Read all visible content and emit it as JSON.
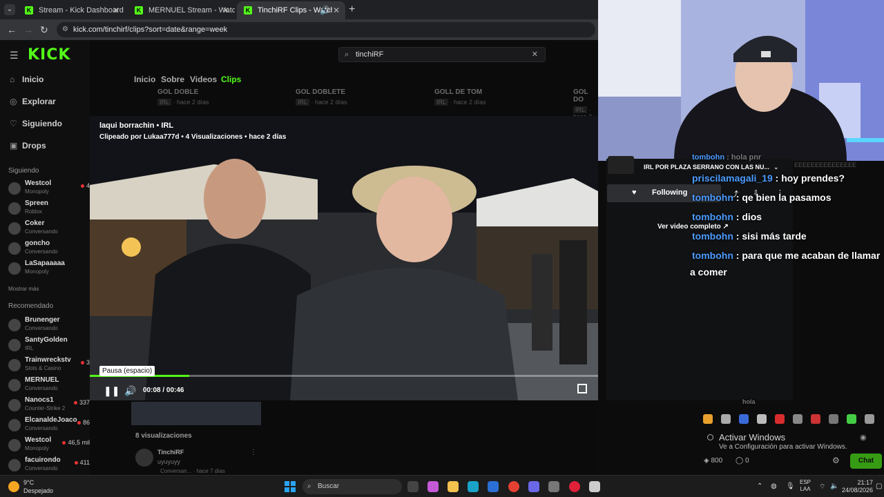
{
  "browser": {
    "tabs": [
      {
        "label": "Stream - Kick Dashboard",
        "active": false
      },
      {
        "label": "MERNUEL Stream - Watch Live",
        "active": false
      },
      {
        "label": "TinchiRF Clips - Watch Live",
        "active": true
      }
    ],
    "tab_close": "✕",
    "new_tab": "+",
    "url": "kick.com/tinchirf/clips?sort=date&range=week"
  },
  "kick": {
    "logo": "KICK",
    "nav": [
      {
        "icon": "home-icon",
        "glyph": "⌂",
        "label": "Inicio"
      },
      {
        "icon": "compass-icon",
        "glyph": "◎",
        "label": "Explorar"
      },
      {
        "icon": "heart-icon",
        "glyph": "♡",
        "label": "Siguiendo"
      },
      {
        "icon": "drops-icon",
        "glyph": "▣",
        "label": "Drops"
      }
    ],
    "following_title": "Siguiendo",
    "following": [
      {
        "name": "Westcol",
        "category": "Monopoly",
        "viewers": "4"
      },
      {
        "name": "Spreen",
        "category": "Roblox",
        "viewers": ""
      },
      {
        "name": "Coker",
        "category": "Conversando",
        "viewers": ""
      },
      {
        "name": "goncho",
        "category": "Conversando",
        "viewers": ""
      },
      {
        "name": "LaSapaaaaa",
        "category": "Monopoly",
        "viewers": ""
      }
    ],
    "show_more": "Mostrar más",
    "recommended_title": "Recomendado",
    "recommended": [
      {
        "name": "Brunenger",
        "category": "Conversando",
        "viewers": ""
      },
      {
        "name": "SantyGolden",
        "category": "IRL",
        "viewers": ""
      },
      {
        "name": "Trainwreckstv",
        "category": "Slots & Casino",
        "viewers": "3"
      },
      {
        "name": "MERNUEL",
        "category": "Conversando",
        "viewers": ""
      },
      {
        "name": "Nanocs1",
        "category": "Counter-Strike 2",
        "viewers": "337"
      },
      {
        "name": "ElcanaldeJoaco",
        "category": "Conversando",
        "viewers": "86"
      },
      {
        "name": "Westcol",
        "category": "Monopoly",
        "viewers": "46,5 mil"
      },
      {
        "name": "facuirondo",
        "category": "Conversando",
        "viewers": "411"
      }
    ],
    "search": {
      "value": "tinchiRF"
    },
    "profile_tabs": [
      "Inicio",
      "Sobre",
      "Videos",
      "Clips"
    ],
    "bg_clips": [
      {
        "title": "GOL DOBLE",
        "tag": "IRL",
        "age": "hace 2 días"
      },
      {
        "title": "GOL DOBLETE",
        "tag": "IRL",
        "age": "hace 2 días"
      },
      {
        "title": "GOLL DE TOM",
        "tag": "IRL",
        "age": "hace 2 días"
      },
      {
        "title": "GOL DO",
        "tag": "IRL",
        "age": "hace 2 días"
      }
    ],
    "player": {
      "title": "laqui borrachin • IRL",
      "subtitle": "Clipeado por Lukaa777d • 4 Visualizaciones • hace 2 días",
      "tooltip": "Pausa (espacio)",
      "time": "00:08 / 00:46",
      "progress": 0.195
    },
    "below": {
      "views": "8 visualizaciones",
      "comment_user": "TinchiRF",
      "comment_text": "uyuyuyy",
      "comment_meta": "Conversan... · hace 7 días"
    }
  },
  "stream_panel": {
    "title": "IRL POR PLAZA SERRANO CON LAS NU...",
    "follow_label": "Following",
    "ver_video": "Ver video completo",
    "eee": "EEEEEEEEEEEEEEE"
  },
  "chat": [
    {
      "user": "tombohn",
      "text": ": hola pnr",
      "dim": true
    },
    {
      "user": "priscilamagali_19",
      "text": ": hoy prendes?",
      "dim": false
    },
    {
      "user": "tombohn",
      "text": ": qe bien la pasamos",
      "dim": false
    },
    {
      "user": "tombohn",
      "text": ": dios",
      "dim": false
    },
    {
      "user": "tombohn",
      "text": ": sisi más tarde",
      "dim": false
    },
    {
      "user": "tombohn",
      "text": ": para que me acaban de llamar",
      "dim": false
    },
    {
      "user": "",
      "text": "a comer",
      "dim": false
    }
  ],
  "chat_ghost": "hola",
  "activate": {
    "title": "Activar Windows",
    "subtitle": "Ve a Configuración para activar Windows."
  },
  "chatbar": {
    "points": "800",
    "points2": "0",
    "chat_button": "Chat"
  },
  "taskbar": {
    "temp": "9°C",
    "weather": "Despejado",
    "search": "Buscar",
    "lang_top": "ESP",
    "lang_bottom": "LAA",
    "time": "21:17",
    "date": "24/08/2026"
  },
  "colors": {
    "kick_green": "#53fc18",
    "chat_user": "#4b9bff"
  }
}
